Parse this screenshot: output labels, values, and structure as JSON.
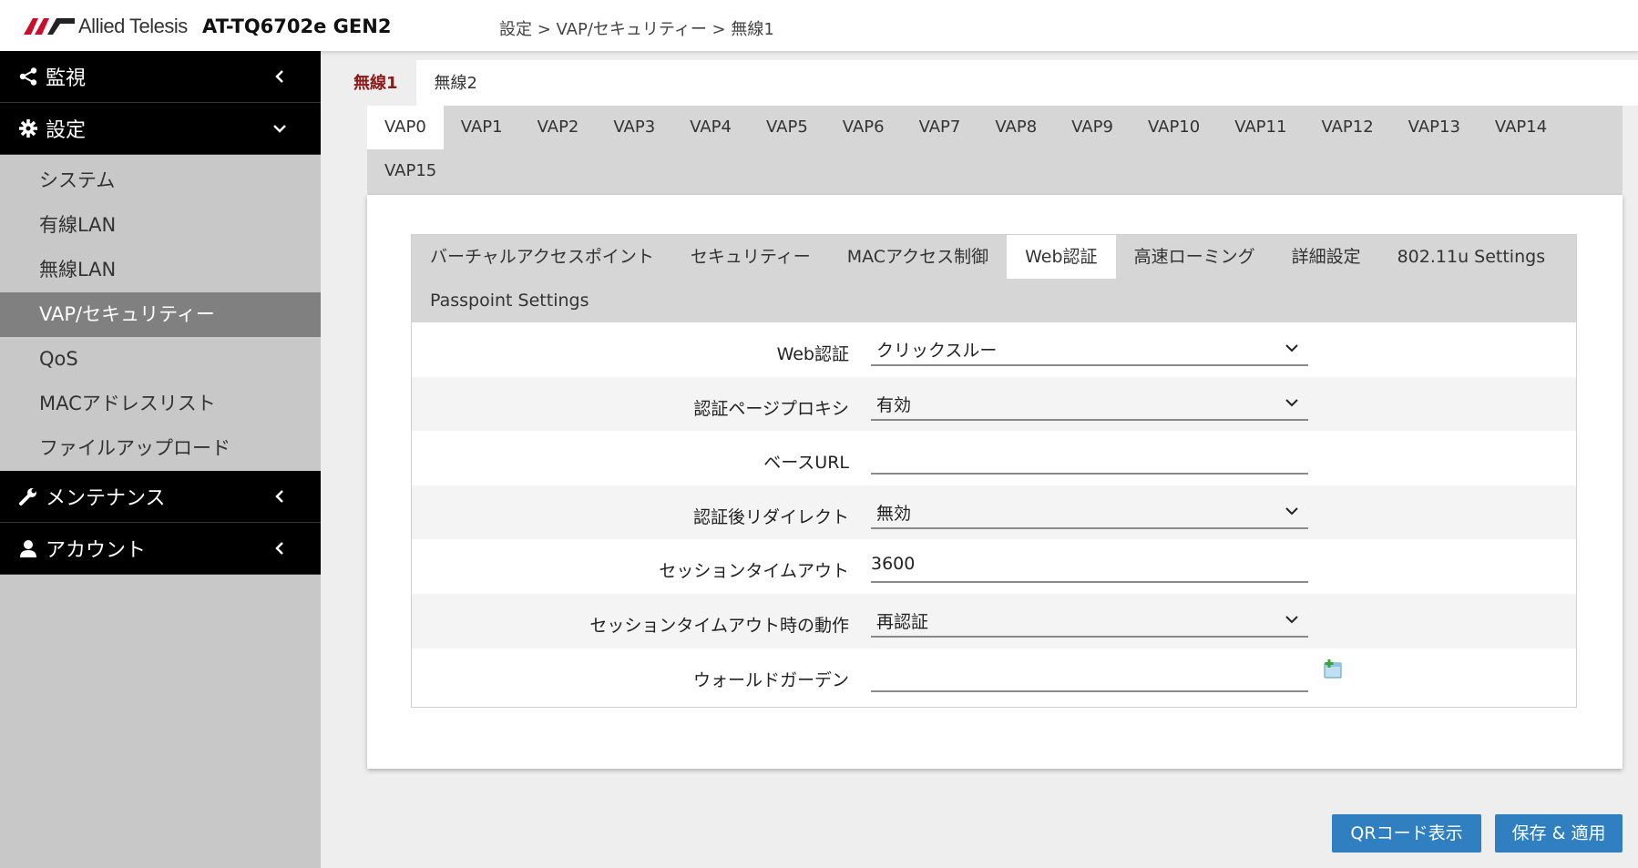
{
  "header": {
    "logo_text": "Allied Telesis",
    "model": "AT-TQ6702e GEN2",
    "breadcrumb": "設定 > VAP/セキュリティー > 無線1"
  },
  "sidebar": {
    "sections": [
      {
        "label": "監視",
        "icon": "share-icon"
      },
      {
        "label": "設定",
        "icon": "gear-icon"
      },
      {
        "label": "メンテナンス",
        "icon": "wrench-icon"
      },
      {
        "label": "アカウント",
        "icon": "user-icon"
      }
    ],
    "settings_items": [
      "システム",
      "有線LAN",
      "無線LAN",
      "VAP/セキュリティー",
      "QoS",
      "MACアドレスリスト",
      "ファイルアップロード"
    ],
    "active_item": "VAP/セキュリティー"
  },
  "radio_tabs": [
    "無線1",
    "無線2"
  ],
  "vap_tabs": [
    "VAP0",
    "VAP1",
    "VAP2",
    "VAP3",
    "VAP4",
    "VAP5",
    "VAP6",
    "VAP7",
    "VAP8",
    "VAP9",
    "VAP10",
    "VAP11",
    "VAP12",
    "VAP13",
    "VAP14",
    "VAP15"
  ],
  "sub_tabs": [
    "バーチャルアクセスポイント",
    "セキュリティー",
    "MACアクセス制御",
    "Web認証",
    "高速ローミング",
    "詳細設定",
    "802.11u Settings",
    "Passpoint Settings"
  ],
  "form": {
    "web_auth": {
      "label": "Web認証",
      "value": "クリックスルー"
    },
    "proxy": {
      "label": "認証ページプロキシ",
      "value": "有効"
    },
    "base_url": {
      "label": "ベースURL",
      "value": ""
    },
    "redirect": {
      "label": "認証後リダイレクト",
      "value": "無効"
    },
    "session_timeout": {
      "label": "セッションタイムアウト",
      "value": "3600"
    },
    "timeout_action": {
      "label": "セッションタイムアウト時の動作",
      "value": "再認証"
    },
    "walled_garden": {
      "label": "ウォールドガーデン",
      "value": ""
    }
  },
  "buttons": {
    "qr": "QRコード表示",
    "save": "保存 & 適用"
  },
  "colors": {
    "accent_blue": "#2f7fc1",
    "active_radio_tab": "#8b1a1a",
    "sidebar_black": "#000000"
  }
}
